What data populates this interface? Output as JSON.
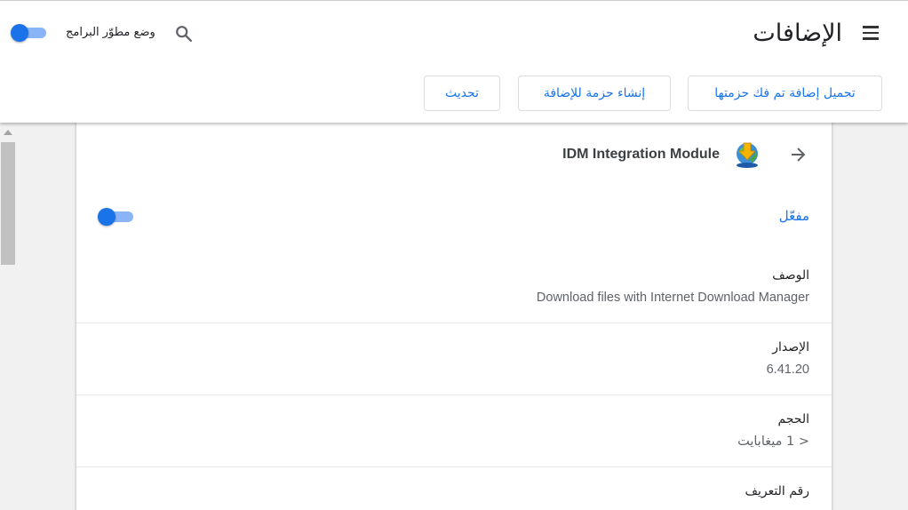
{
  "header": {
    "title": "الإضافات",
    "dev_mode_label": "وضع مطوّر البرامج",
    "dev_mode_enabled": true
  },
  "toolbar": {
    "load_unpacked_label": "تحميل إضافة تم فك حزمتها",
    "pack_extension_label": "إنشاء حزمة للإضافة",
    "update_label": "تحديث"
  },
  "extension": {
    "name": "IDM Integration Module",
    "enabled_label": "مفعّل",
    "enabled": true,
    "details": [
      {
        "label": "الوصف",
        "value": "Download files with Internet Download Manager"
      },
      {
        "label": "الإصدار",
        "value": "6.41.20"
      },
      {
        "label": "الحجم",
        "value": "< 1 ميغابايت"
      },
      {
        "label": "رقم التعريف",
        "value": ""
      }
    ]
  },
  "icons": {
    "menu": "hamburger-menu-icon",
    "search": "search-icon",
    "back": "arrow-back-icon",
    "extension": "idm-logo-icon"
  },
  "colors": {
    "accent": "#1a73e8",
    "toggle_track": "#8ab4f8"
  }
}
